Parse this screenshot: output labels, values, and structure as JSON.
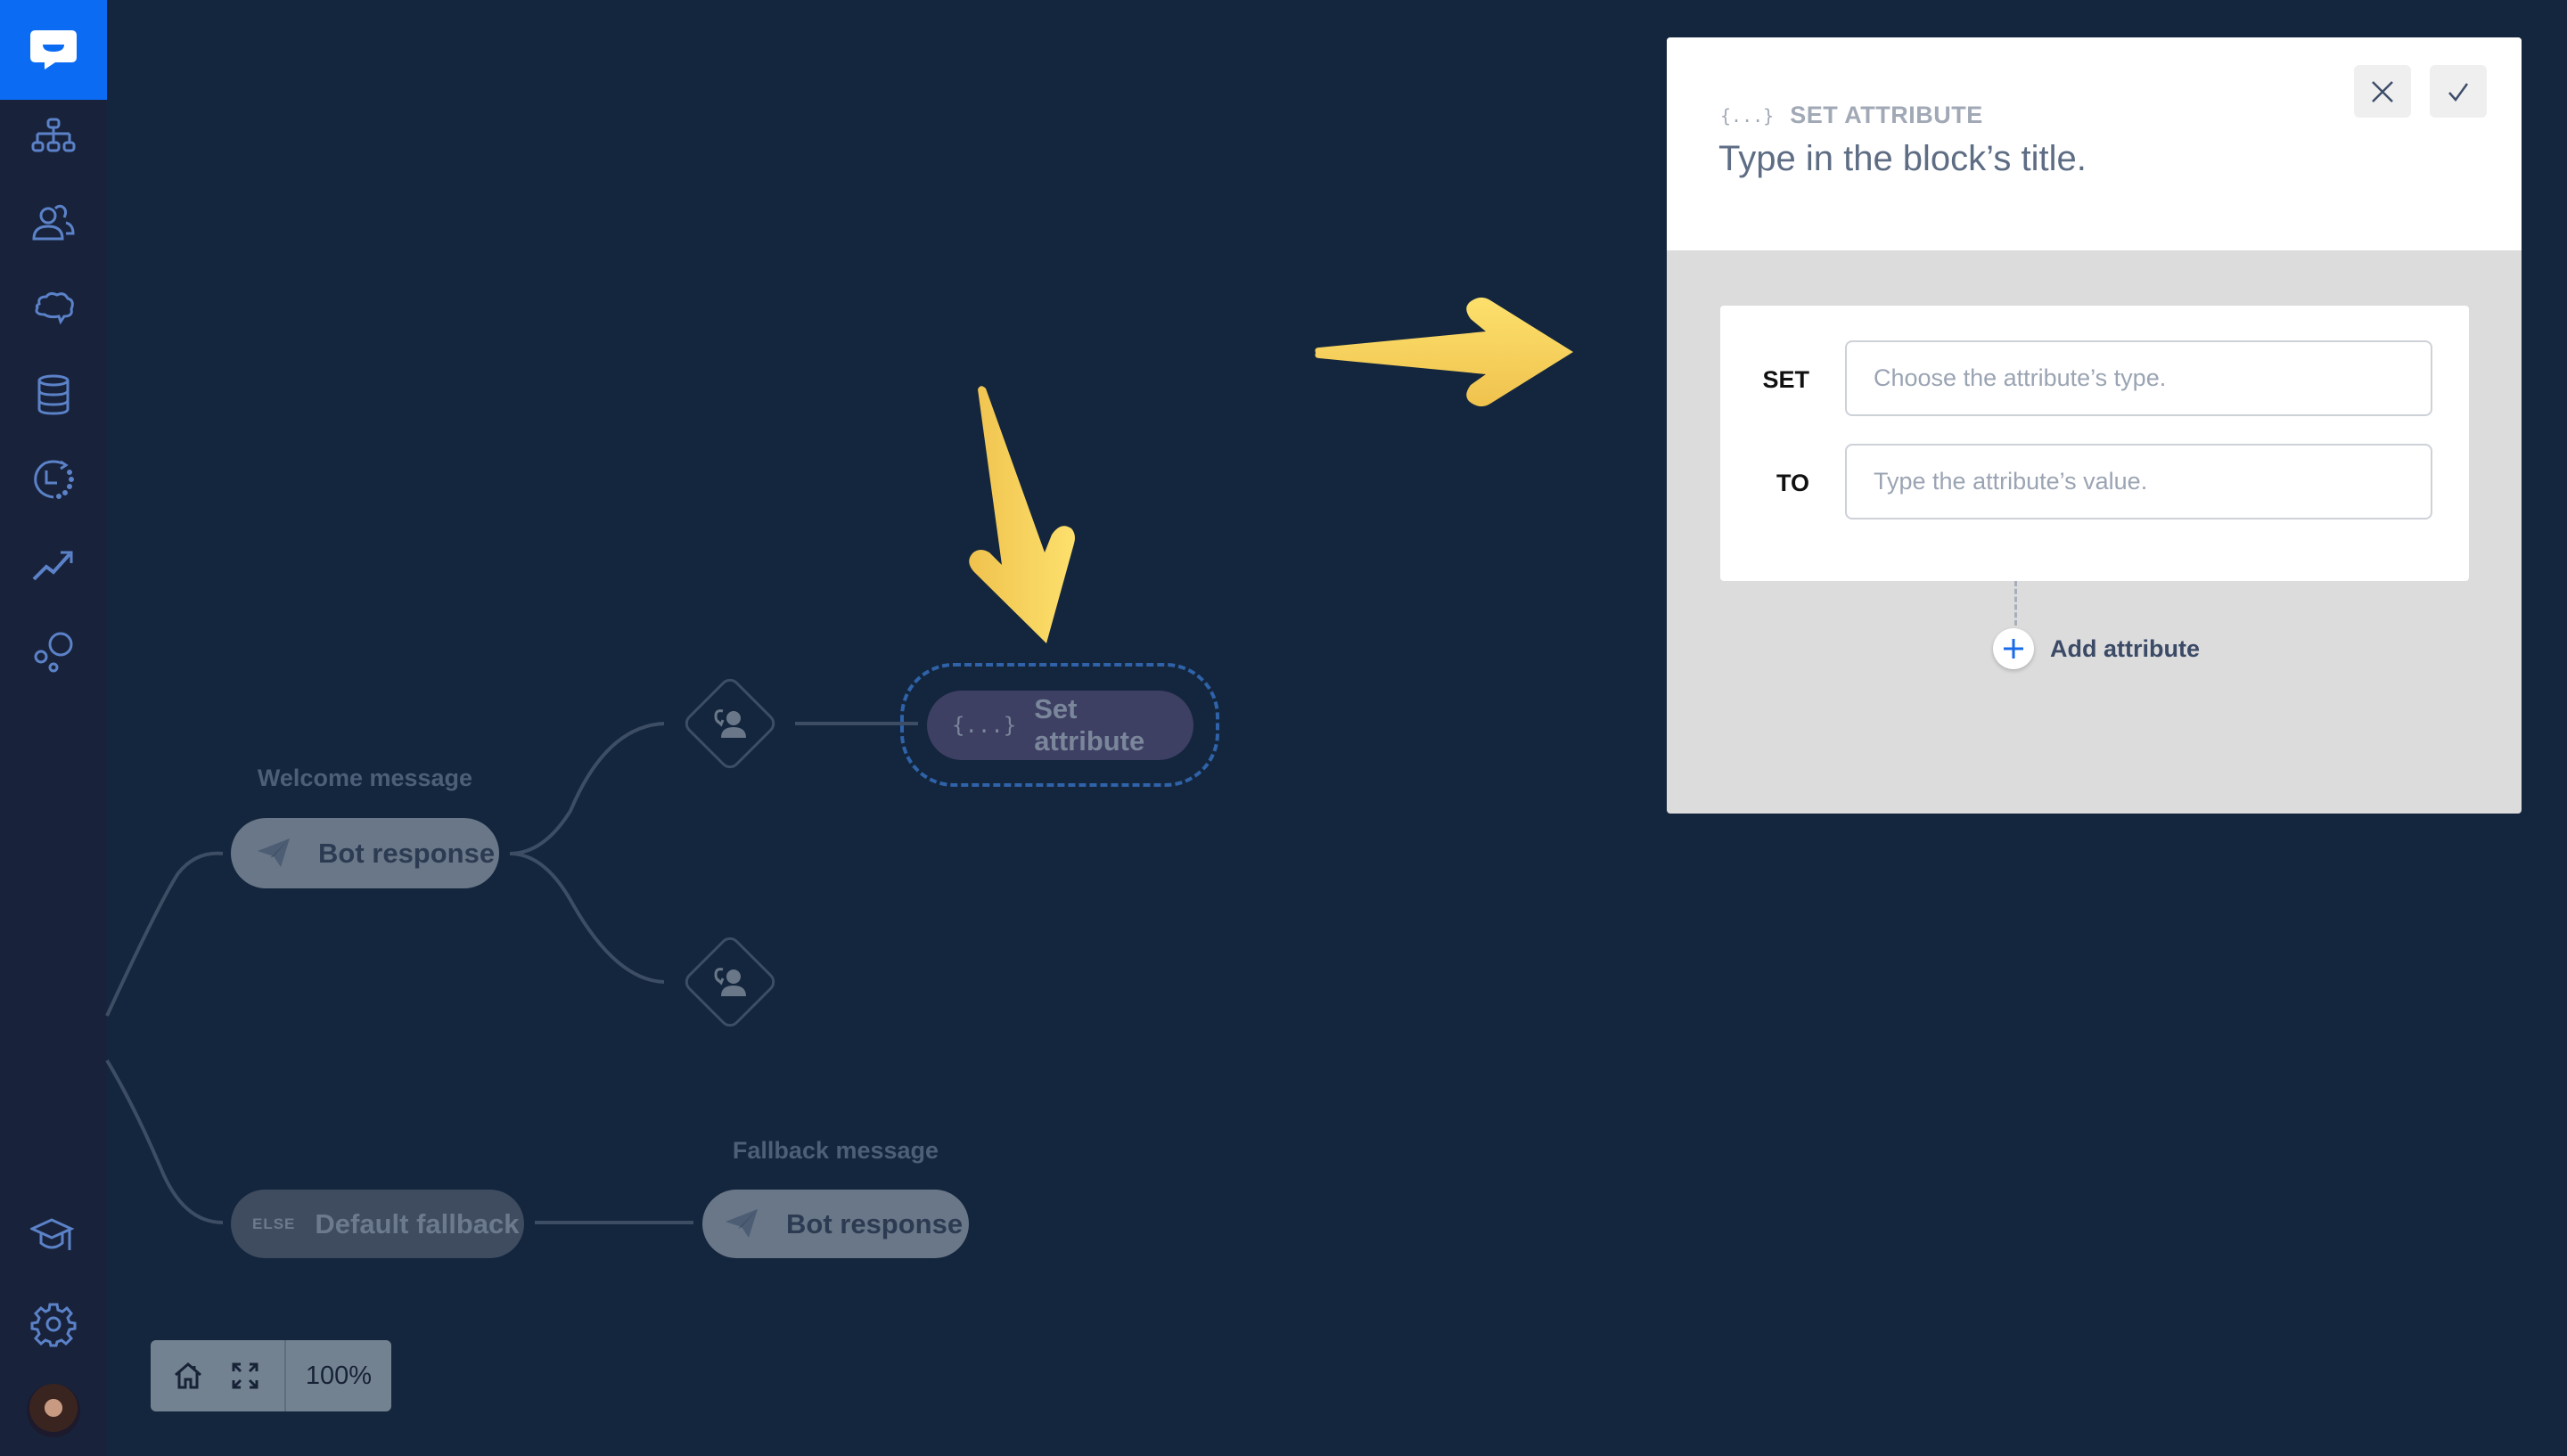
{
  "sidebar": {
    "logo": "chatbot-logo-icon",
    "items": [
      {
        "icon": "stories-tree-icon",
        "label": "Stories"
      },
      {
        "icon": "users-icon",
        "label": "Users"
      },
      {
        "icon": "brain-icon",
        "label": "Training"
      },
      {
        "icon": "database-icon",
        "label": "Data"
      },
      {
        "icon": "history-icon",
        "label": "History"
      },
      {
        "icon": "analytics-icon",
        "label": "Analytics"
      },
      {
        "icon": "integrations-icon",
        "label": "Integrations"
      }
    ],
    "bottom": [
      {
        "icon": "academy-icon",
        "label": "Academy"
      },
      {
        "icon": "settings-icon",
        "label": "Settings"
      },
      {
        "icon": "avatar",
        "label": "User profile"
      }
    ]
  },
  "canvas": {
    "nodes": {
      "welcome_label": "Welcome message",
      "welcome_bot": "Bot response",
      "set_attribute": "Set attribute",
      "set_attribute_icon": "{...}",
      "else_tag": "ELSE",
      "default_fallback": "Default fallback",
      "fallback_label": "Fallback message",
      "fallback_bot": "Bot response"
    },
    "zoom_control": {
      "home": "home-icon",
      "fit": "fit-screen-icon",
      "zoom_level": "100%"
    }
  },
  "panel": {
    "kicker_icon": "{...}",
    "kicker": "SET ATTRIBUTE",
    "title_placeholder": "Type in the block’s title.",
    "title_value": "",
    "close_label": "Close",
    "confirm_label": "Confirm",
    "set_label": "SET",
    "set_placeholder": "Choose the attribute’s type.",
    "set_value": "",
    "to_label": "TO",
    "to_placeholder": "Type the attribute’s value.",
    "to_value": "",
    "add_attribute": "Add attribute"
  },
  "colors": {
    "brand": "#0b6cf3",
    "canvas_bg": "#13263d",
    "sidebar_bg": "#18223a",
    "sidebar_icon": "#5b82c8",
    "annotation_arrow": "#fcd65e",
    "selection_dash": "#2f62a8"
  }
}
